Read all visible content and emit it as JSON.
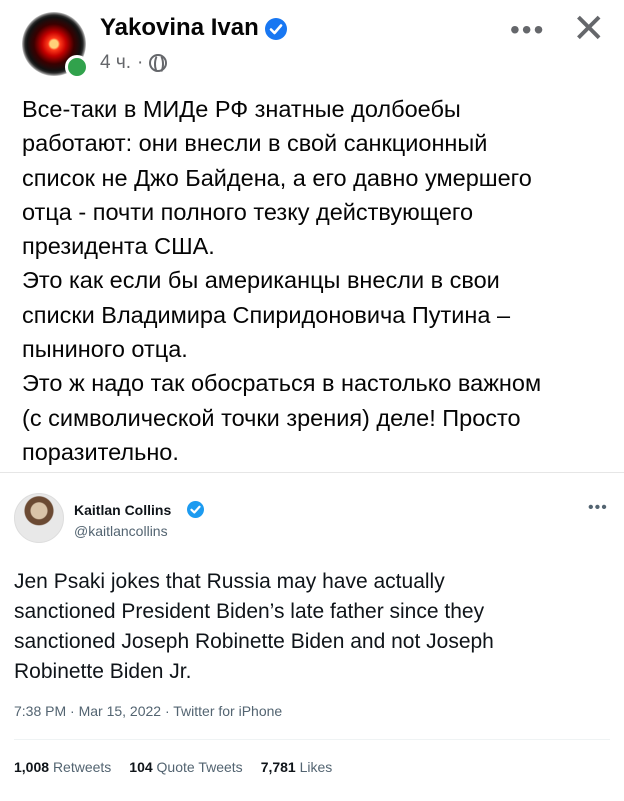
{
  "post": {
    "author": "Yakovina Ivan",
    "time": "4 ч.",
    "separator": "·",
    "more": "•••",
    "close": "✕",
    "lines": [
      "Все-таки в МИДе РФ знатные долбоебы",
      "работают: они внесли в свой санкционный",
      "список не Джо Байдена, а его давно умершего",
      "отца - почти полного тезку действующего",
      "президента США.",
      "Это как если бы американцы внесли в свои",
      "списки Владимира Спиридоновича Путина –",
      "пыниного отца.",
      "Это ж надо так обосраться в настолько важном",
      "(с символической точки зрения) деле! Просто",
      "поразительно."
    ]
  },
  "tweet": {
    "name": "Kaitlan Collins",
    "handle": "@kaitlancollins",
    "more": "•••",
    "text_lines": [
      "Jen Psaki jokes that Russia may have actually",
      "sanctioned President Biden’s late father since they",
      "sanctioned Joseph Robinette Biden and not Joseph",
      "Robinette Biden Jr."
    ],
    "timestamp": "7:38 PM · Mar 15, 2022 · Twitter for iPhone",
    "stats": {
      "retweets_count": "1,008",
      "retweets_label": "Retweets",
      "quotes_count": "104",
      "quotes_label": "Quote Tweets",
      "likes_count": "7,781",
      "likes_label": "Likes"
    }
  },
  "colors": {
    "facebook_blue": "#1877f2",
    "twitter_blue": "#1d9bf0",
    "online_green": "#31a24c"
  },
  "icons": [
    "hal-avatar",
    "online-status-icon",
    "verified-icon",
    "globe-icon",
    "more-icon",
    "close-icon"
  ]
}
